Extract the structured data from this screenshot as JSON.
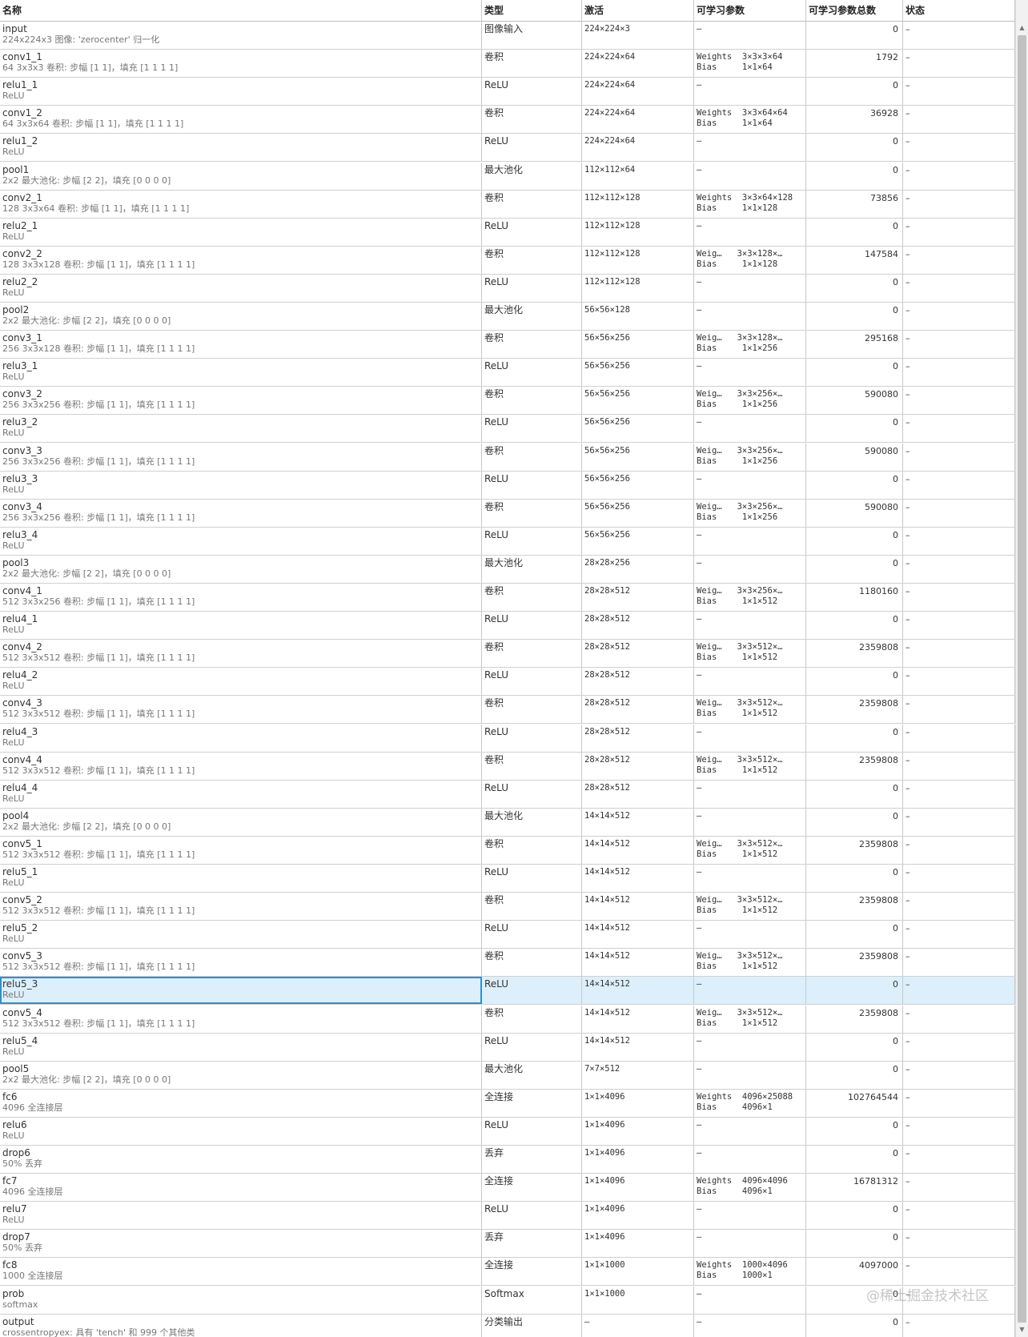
{
  "headers": [
    "名称",
    "类型",
    "激活",
    "可学习参数",
    "可学习参数总数",
    "状态"
  ],
  "selected_row": 34,
  "watermark": "@稀土掘金技术社区",
  "rows": [
    {
      "name": "input",
      "desc": "224x224x3 图像: 'zerocenter' 归一化",
      "type": "图像输入",
      "act": "224×224×3",
      "p1": "–",
      "p2": "",
      "total": "0",
      "state": "–"
    },
    {
      "name": "conv1_1",
      "desc": "64 3x3x3 卷积: 步幅 [1 1]，填充 [1 1 1 1]",
      "type": "卷积",
      "act": "224×224×64",
      "p1": "Weights  3×3×3×64",
      "p2": "Bias     1×1×64",
      "total": "1792",
      "state": "–"
    },
    {
      "name": "relu1_1",
      "desc": "ReLU",
      "type": "ReLU",
      "act": "224×224×64",
      "p1": "–",
      "p2": "",
      "total": "0",
      "state": "–"
    },
    {
      "name": "conv1_2",
      "desc": "64 3x3x64 卷积: 步幅 [1 1]，填充 [1 1 1 1]",
      "type": "卷积",
      "act": "224×224×64",
      "p1": "Weights  3×3×64×64",
      "p2": "Bias     1×1×64",
      "total": "36928",
      "state": "–"
    },
    {
      "name": "relu1_2",
      "desc": "ReLU",
      "type": "ReLU",
      "act": "224×224×64",
      "p1": "–",
      "p2": "",
      "total": "0",
      "state": "–"
    },
    {
      "name": "pool1",
      "desc": "2x2 最大池化: 步幅 [2 2]，填充 [0 0 0 0]",
      "type": "最大池化",
      "act": "112×112×64",
      "p1": "–",
      "p2": "",
      "total": "0",
      "state": "–"
    },
    {
      "name": "conv2_1",
      "desc": "128 3x3x64 卷积: 步幅 [1 1]，填充 [1 1 1 1]",
      "type": "卷积",
      "act": "112×112×128",
      "p1": "Weights  3×3×64×128",
      "p2": "Bias     1×1×128",
      "total": "73856",
      "state": "–"
    },
    {
      "name": "relu2_1",
      "desc": "ReLU",
      "type": "ReLU",
      "act": "112×112×128",
      "p1": "–",
      "p2": "",
      "total": "0",
      "state": "–"
    },
    {
      "name": "conv2_2",
      "desc": "128 3x3x128 卷积: 步幅 [1 1]，填充 [1 1 1 1]",
      "type": "卷积",
      "act": "112×112×128",
      "p1": "Weig…   3×3×128×…",
      "p2": "Bias     1×1×128",
      "total": "147584",
      "state": "–"
    },
    {
      "name": "relu2_2",
      "desc": "ReLU",
      "type": "ReLU",
      "act": "112×112×128",
      "p1": "–",
      "p2": "",
      "total": "0",
      "state": "–"
    },
    {
      "name": "pool2",
      "desc": "2x2 最大池化: 步幅 [2 2]，填充 [0 0 0 0]",
      "type": "最大池化",
      "act": "56×56×128",
      "p1": "–",
      "p2": "",
      "total": "0",
      "state": "–"
    },
    {
      "name": "conv3_1",
      "desc": "256 3x3x128 卷积: 步幅 [1 1]，填充 [1 1 1 1]",
      "type": "卷积",
      "act": "56×56×256",
      "p1": "Weig…   3×3×128×…",
      "p2": "Bias     1×1×256",
      "total": "295168",
      "state": "–"
    },
    {
      "name": "relu3_1",
      "desc": "ReLU",
      "type": "ReLU",
      "act": "56×56×256",
      "p1": "–",
      "p2": "",
      "total": "0",
      "state": "–"
    },
    {
      "name": "conv3_2",
      "desc": "256 3x3x256 卷积: 步幅 [1 1]，填充 [1 1 1 1]",
      "type": "卷积",
      "act": "56×56×256",
      "p1": "Weig…   3×3×256×…",
      "p2": "Bias     1×1×256",
      "total": "590080",
      "state": "–"
    },
    {
      "name": "relu3_2",
      "desc": "ReLU",
      "type": "ReLU",
      "act": "56×56×256",
      "p1": "–",
      "p2": "",
      "total": "0",
      "state": "–"
    },
    {
      "name": "conv3_3",
      "desc": "256 3x3x256 卷积: 步幅 [1 1]，填充 [1 1 1 1]",
      "type": "卷积",
      "act": "56×56×256",
      "p1": "Weig…   3×3×256×…",
      "p2": "Bias     1×1×256",
      "total": "590080",
      "state": "–"
    },
    {
      "name": "relu3_3",
      "desc": "ReLU",
      "type": "ReLU",
      "act": "56×56×256",
      "p1": "–",
      "p2": "",
      "total": "0",
      "state": "–"
    },
    {
      "name": "conv3_4",
      "desc": "256 3x3x256 卷积: 步幅 [1 1]，填充 [1 1 1 1]",
      "type": "卷积",
      "act": "56×56×256",
      "p1": "Weig…   3×3×256×…",
      "p2": "Bias     1×1×256",
      "total": "590080",
      "state": "–"
    },
    {
      "name": "relu3_4",
      "desc": "ReLU",
      "type": "ReLU",
      "act": "56×56×256",
      "p1": "–",
      "p2": "",
      "total": "0",
      "state": "–"
    },
    {
      "name": "pool3",
      "desc": "2x2 最大池化: 步幅 [2 2]，填充 [0 0 0 0]",
      "type": "最大池化",
      "act": "28×28×256",
      "p1": "–",
      "p2": "",
      "total": "0",
      "state": "–"
    },
    {
      "name": "conv4_1",
      "desc": "512 3x3x256 卷积: 步幅 [1 1]，填充 [1 1 1 1]",
      "type": "卷积",
      "act": "28×28×512",
      "p1": "Weig…   3×3×256×…",
      "p2": "Bias     1×1×512",
      "total": "1180160",
      "state": "–"
    },
    {
      "name": "relu4_1",
      "desc": "ReLU",
      "type": "ReLU",
      "act": "28×28×512",
      "p1": "–",
      "p2": "",
      "total": "0",
      "state": "–"
    },
    {
      "name": "conv4_2",
      "desc": "512 3x3x512 卷积: 步幅 [1 1]，填充 [1 1 1 1]",
      "type": "卷积",
      "act": "28×28×512",
      "p1": "Weig…   3×3×512×…",
      "p2": "Bias     1×1×512",
      "total": "2359808",
      "state": "–"
    },
    {
      "name": "relu4_2",
      "desc": "ReLU",
      "type": "ReLU",
      "act": "28×28×512",
      "p1": "–",
      "p2": "",
      "total": "0",
      "state": "–"
    },
    {
      "name": "conv4_3",
      "desc": "512 3x3x512 卷积: 步幅 [1 1]，填充 [1 1 1 1]",
      "type": "卷积",
      "act": "28×28×512",
      "p1": "Weig…   3×3×512×…",
      "p2": "Bias     1×1×512",
      "total": "2359808",
      "state": "–"
    },
    {
      "name": "relu4_3",
      "desc": "ReLU",
      "type": "ReLU",
      "act": "28×28×512",
      "p1": "–",
      "p2": "",
      "total": "0",
      "state": "–"
    },
    {
      "name": "conv4_4",
      "desc": "512 3x3x512 卷积: 步幅 [1 1]，填充 [1 1 1 1]",
      "type": "卷积",
      "act": "28×28×512",
      "p1": "Weig…   3×3×512×…",
      "p2": "Bias     1×1×512",
      "total": "2359808",
      "state": "–"
    },
    {
      "name": "relu4_4",
      "desc": "ReLU",
      "type": "ReLU",
      "act": "28×28×512",
      "p1": "–",
      "p2": "",
      "total": "0",
      "state": "–"
    },
    {
      "name": "pool4",
      "desc": "2x2 最大池化: 步幅 [2 2]，填充 [0 0 0 0]",
      "type": "最大池化",
      "act": "14×14×512",
      "p1": "–",
      "p2": "",
      "total": "0",
      "state": "–"
    },
    {
      "name": "conv5_1",
      "desc": "512 3x3x512 卷积: 步幅 [1 1]，填充 [1 1 1 1]",
      "type": "卷积",
      "act": "14×14×512",
      "p1": "Weig…   3×3×512×…",
      "p2": "Bias     1×1×512",
      "total": "2359808",
      "state": "–"
    },
    {
      "name": "relu5_1",
      "desc": "ReLU",
      "type": "ReLU",
      "act": "14×14×512",
      "p1": "–",
      "p2": "",
      "total": "0",
      "state": "–"
    },
    {
      "name": "conv5_2",
      "desc": "512 3x3x512 卷积: 步幅 [1 1]，填充 [1 1 1 1]",
      "type": "卷积",
      "act": "14×14×512",
      "p1": "Weig…   3×3×512×…",
      "p2": "Bias     1×1×512",
      "total": "2359808",
      "state": "–"
    },
    {
      "name": "relu5_2",
      "desc": "ReLU",
      "type": "ReLU",
      "act": "14×14×512",
      "p1": "–",
      "p2": "",
      "total": "0",
      "state": "–"
    },
    {
      "name": "conv5_3",
      "desc": "512 3x3x512 卷积: 步幅 [1 1]，填充 [1 1 1 1]",
      "type": "卷积",
      "act": "14×14×512",
      "p1": "Weig…   3×3×512×…",
      "p2": "Bias     1×1×512",
      "total": "2359808",
      "state": "–"
    },
    {
      "name": "relu5_3",
      "desc": "ReLU",
      "type": "ReLU",
      "act": "14×14×512",
      "p1": "–",
      "p2": "",
      "total": "0",
      "state": "–"
    },
    {
      "name": "conv5_4",
      "desc": "512 3x3x512 卷积: 步幅 [1 1]，填充 [1 1 1 1]",
      "type": "卷积",
      "act": "14×14×512",
      "p1": "Weig…   3×3×512×…",
      "p2": "Bias     1×1×512",
      "total": "2359808",
      "state": "–"
    },
    {
      "name": "relu5_4",
      "desc": "ReLU",
      "type": "ReLU",
      "act": "14×14×512",
      "p1": "–",
      "p2": "",
      "total": "0",
      "state": "–"
    },
    {
      "name": "pool5",
      "desc": "2x2 最大池化: 步幅 [2 2]，填充 [0 0 0 0]",
      "type": "最大池化",
      "act": "7×7×512",
      "p1": "–",
      "p2": "",
      "total": "0",
      "state": "–"
    },
    {
      "name": "fc6",
      "desc": "4096 全连接层",
      "type": "全连接",
      "act": "1×1×4096",
      "p1": "Weights  4096×25088",
      "p2": "Bias     4096×1",
      "total": "102764544",
      "state": "–"
    },
    {
      "name": "relu6",
      "desc": "ReLU",
      "type": "ReLU",
      "act": "1×1×4096",
      "p1": "–",
      "p2": "",
      "total": "0",
      "state": "–"
    },
    {
      "name": "drop6",
      "desc": "50% 丢弃",
      "type": "丢弃",
      "act": "1×1×4096",
      "p1": "–",
      "p2": "",
      "total": "0",
      "state": "–"
    },
    {
      "name": "fc7",
      "desc": "4096 全连接层",
      "type": "全连接",
      "act": "1×1×4096",
      "p1": "Weights  4096×4096",
      "p2": "Bias     4096×1",
      "total": "16781312",
      "state": "–"
    },
    {
      "name": "relu7",
      "desc": "ReLU",
      "type": "ReLU",
      "act": "1×1×4096",
      "p1": "–",
      "p2": "",
      "total": "0",
      "state": "–"
    },
    {
      "name": "drop7",
      "desc": "50% 丢弃",
      "type": "丢弃",
      "act": "1×1×4096",
      "p1": "–",
      "p2": "",
      "total": "0",
      "state": "–"
    },
    {
      "name": "fc8",
      "desc": "1000 全连接层",
      "type": "全连接",
      "act": "1×1×1000",
      "p1": "Weights  1000×4096",
      "p2": "Bias     1000×1",
      "total": "4097000",
      "state": "–"
    },
    {
      "name": "prob",
      "desc": "softmax",
      "type": "Softmax",
      "act": "1×1×1000",
      "p1": "–",
      "p2": "",
      "total": "0",
      "state": "–"
    },
    {
      "name": "output",
      "desc": "crossentropyex: 具有 'tench' 和 999 个其他类",
      "type": "分类输出",
      "act": "–",
      "p1": "–",
      "p2": "",
      "total": "0",
      "state": "–"
    }
  ]
}
